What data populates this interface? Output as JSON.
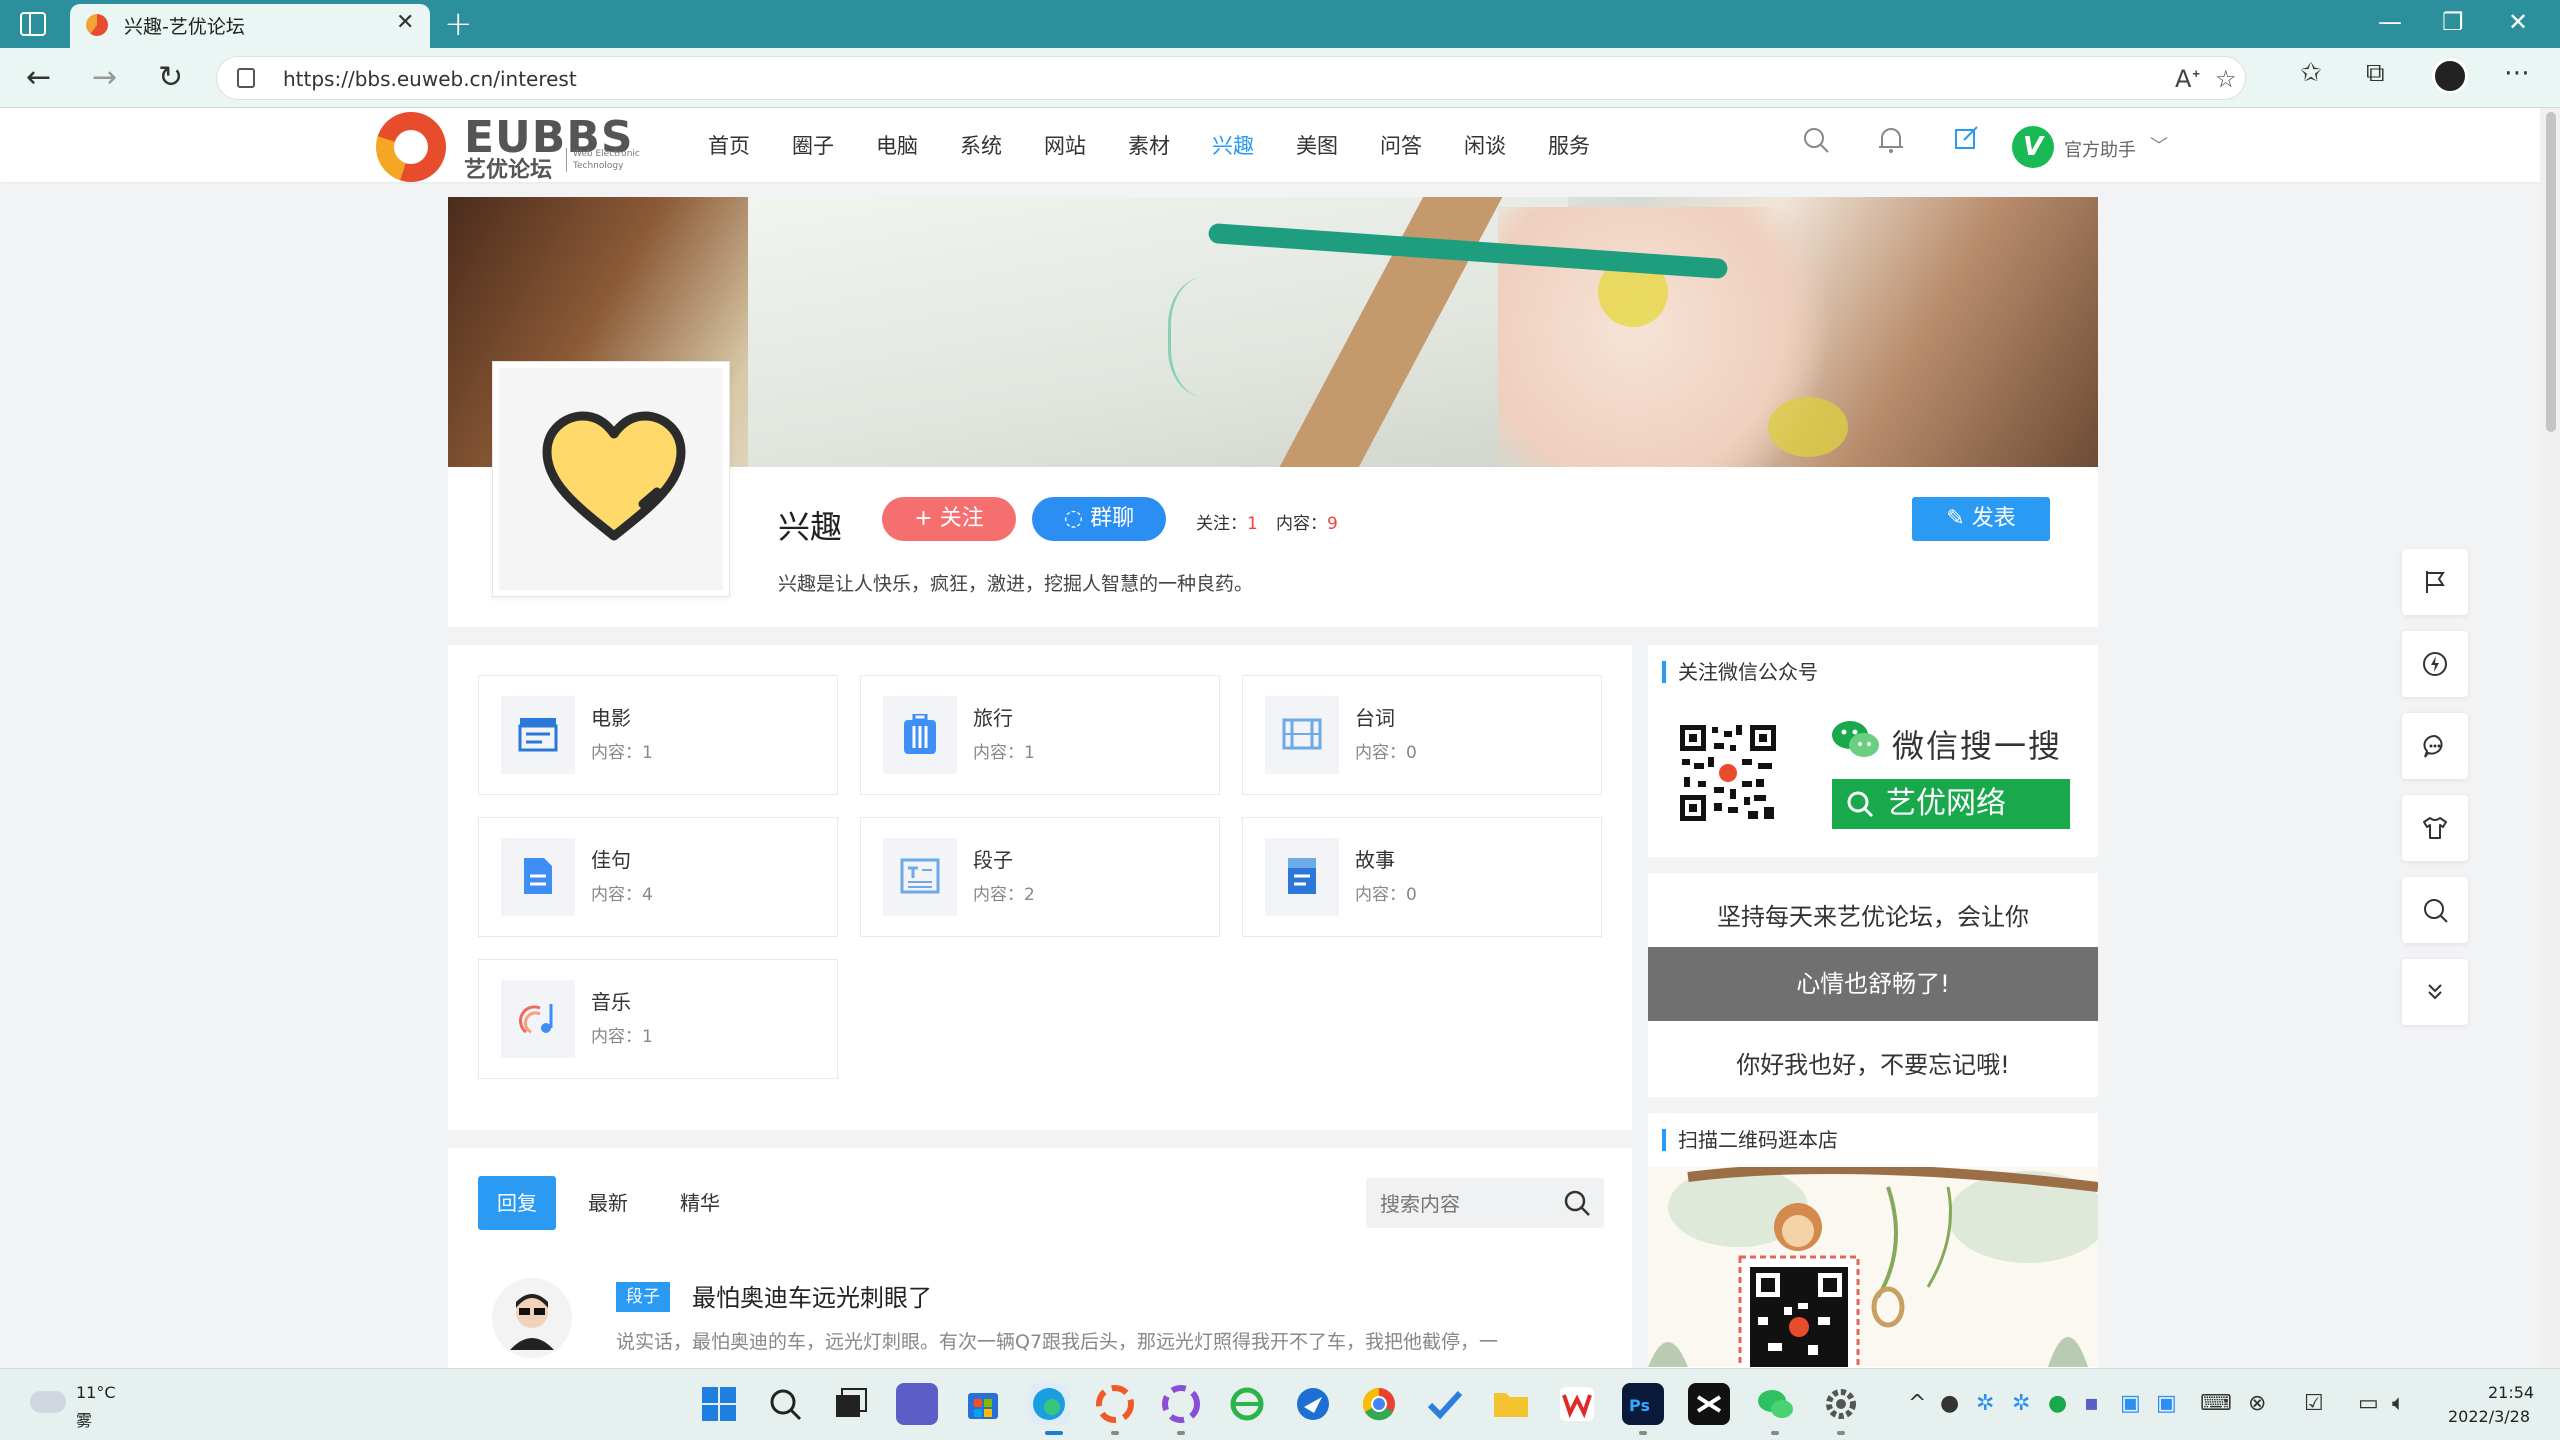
{
  "browser": {
    "tab_title": "兴趣-艺优论坛",
    "url": "https://bbs.euweb.cn/interest"
  },
  "site": {
    "logo_title": "EUBBS",
    "logo_sub": "艺优论坛",
    "logo_sub_en": "Web Electronic Technology",
    "nav": [
      "首页",
      "圈子",
      "电脑",
      "系统",
      "网站",
      "素材",
      "兴趣",
      "美图",
      "问答",
      "闲谈",
      "服务"
    ],
    "nav_active": "兴趣",
    "user_badge": "V",
    "user_name": "官方助手"
  },
  "circle": {
    "name": "兴趣",
    "follow_label": "+ 关注",
    "chat_label": "群聊",
    "follow_stat_label": "关注：",
    "follow_stat_value": "1",
    "content_stat_label": "内容：",
    "content_stat_value": "9",
    "post_label": "发表",
    "description": "兴趣是让人快乐，疯狂，激进，挖掘人智慧的一种良药。"
  },
  "topics": [
    {
      "name": "电影",
      "count_label": "内容：",
      "count": "1",
      "icon": "clapperboard-icon"
    },
    {
      "name": "旅行",
      "count_label": "内容：",
      "count": "1",
      "icon": "suitcase-icon"
    },
    {
      "name": "台词",
      "count_label": "内容：",
      "count": "0",
      "icon": "film-icon"
    },
    {
      "name": "佳句",
      "count_label": "内容：",
      "count": "4",
      "icon": "document-icon"
    },
    {
      "name": "段子",
      "count_label": "内容：",
      "count": "2",
      "icon": "text-icon"
    },
    {
      "name": "故事",
      "count_label": "内容：",
      "count": "0",
      "icon": "book-icon"
    },
    {
      "name": "音乐",
      "count_label": "内容：",
      "count": "1",
      "icon": "music-icon"
    }
  ],
  "posts": {
    "tabs": [
      "回复",
      "最新",
      "精华"
    ],
    "active_tab": "回复",
    "search_placeholder": "搜索内容",
    "items": [
      {
        "tag": "段子",
        "title": "最怕奥迪车远光刺眼了",
        "excerpt": "说实话，最怕奥迪的车，远光灯刺眼。有次一辆Q7跟我后头，那远光灯照得我开不了车，我把他截停，一"
      }
    ]
  },
  "sidebar": {
    "wechat_title": "关注微信公众号",
    "wechat_search_text": "微信搜一搜",
    "wechat_search_button": "艺优网络",
    "slogan_line1": "坚持每天来艺优论坛，会让你",
    "slogan_line2": "心情也舒畅了!",
    "slogan_line3": "你好我也好，不要忘记哦!",
    "shop_title": "扫描二维码逛本店"
  },
  "taskbar": {
    "temperature": "11°C",
    "weather": "雾",
    "time": "21:54",
    "date": "2022/3/28"
  },
  "colors": {
    "accent": "#2b9af3",
    "follow": "#f66f6f",
    "wechat_green": "#19a94c",
    "browser_teal": "#2b8f9c"
  }
}
